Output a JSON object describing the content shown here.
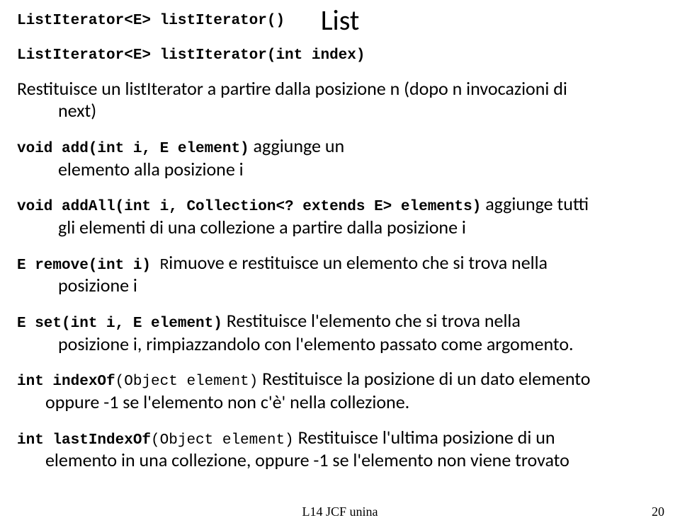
{
  "title": "List",
  "line1_sig": "ListIterator<E> listIterator()",
  "line2_sig": "ListIterator<E> listIterator(int index)",
  "line3_desc_a": "Restituisce un listIterator a partire dalla posizione n (dopo n invocazioni di",
  "line3_desc_b": "next)",
  "line4_sig": "void add(int i, E element)",
  "line4_desc_a": "aggiunge un",
  "line4_desc_b": "elemento alla posizione i",
  "line5_sig": "void addAll(int i, Collection<? extends E> elements)",
  "line5_desc_a": "aggiunge tutti",
  "line5_desc_b": "gli elementi di una collezione a partire dalla posizione i",
  "line6_sig": "E remove(int i)",
  "line6_cap": "R",
  "line6_desc_a": "imuove e restituisce un elemento che si trova nella",
  "line6_desc_b": "posizione i",
  "line7_sig": "E set(int i, E element)",
  "line7_desc_a": "Restituisce l'elemento che si trova nella",
  "line7_desc_b": "posizione i, rimpiazzandolo con l'elemento passato come argomento.",
  "line8_sig": "int indexOf",
  "line8_sig_nb": "(Object element)",
  "line8_desc_a": "Restituisce la posizione di un dato elemento",
  "line8_desc_b": "oppure -1 se l'elemento non c'è' nella collezione.",
  "line9_sig": "int lastIndexOf",
  "line9_sig_nb": "(Object element)",
  "line9_desc_a": "Restituisce l'ultima posizione di un",
  "line9_desc_b": "elemento in una collezione, oppure -1 se l'elemento non viene trovato",
  "footer": "L14 JCF unina",
  "pagenum": "20"
}
